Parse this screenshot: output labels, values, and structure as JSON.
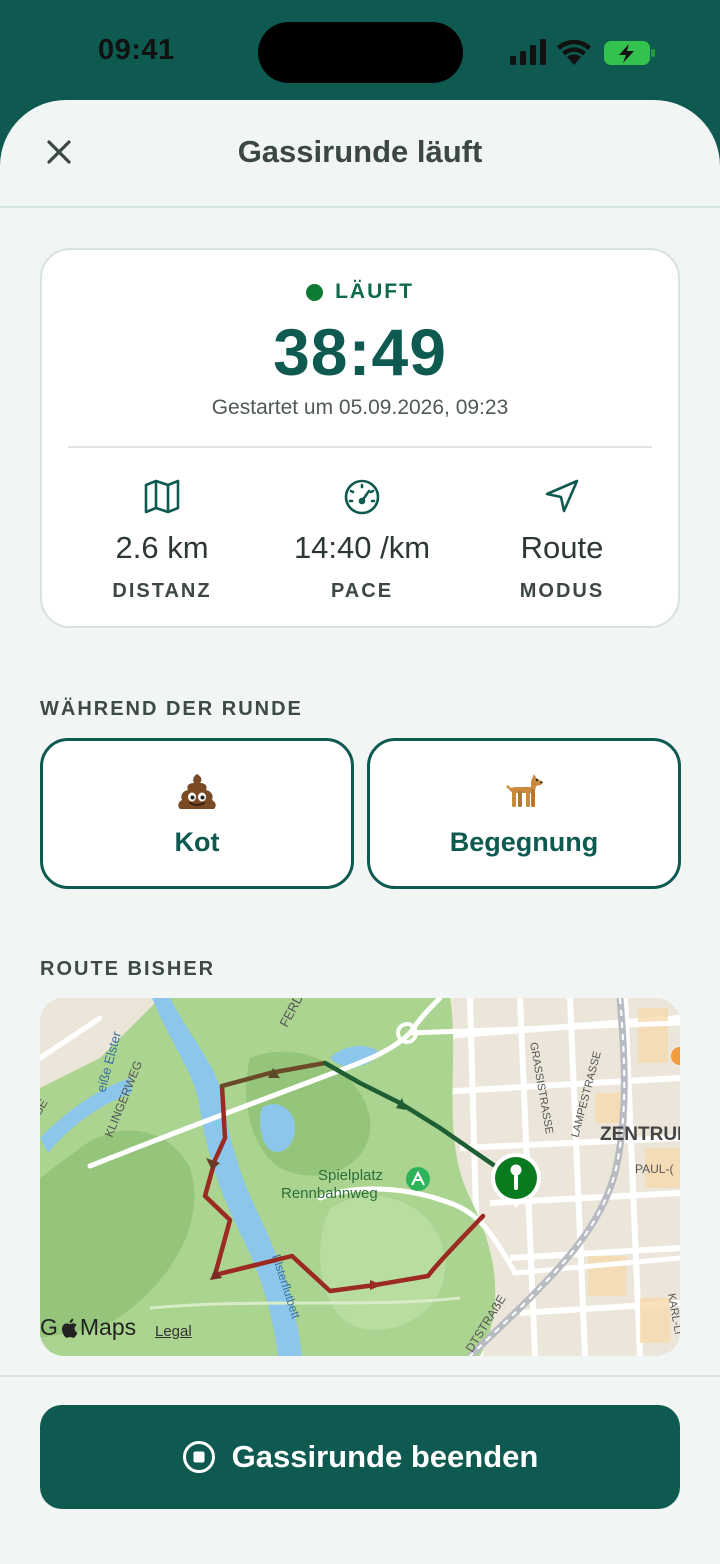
{
  "status_bar": {
    "time": "09:41"
  },
  "header": {
    "title": "Gassirunde läuft",
    "close_icon": "close-icon"
  },
  "timer_card": {
    "status": "LÄUFT",
    "status_color": "#0e7a34",
    "elapsed": "38:49",
    "started_text": "Gestartet um 05.09.2026, 09:23",
    "stats": [
      {
        "icon": "map-icon",
        "value": "2.6 km",
        "label": "DISTANZ"
      },
      {
        "icon": "speedometer-icon",
        "value": "14:40 /km",
        "label": "PACE"
      },
      {
        "icon": "navigation-arrow-icon",
        "value": "Route",
        "label": "MODUS"
      }
    ]
  },
  "during_section": {
    "title": "WÄHREND DER RUNDE",
    "actions": [
      {
        "icon": "poop-emoji",
        "label": "Kot"
      },
      {
        "icon": "dog-emoji",
        "label": "Begegnung"
      }
    ]
  },
  "route_section": {
    "title": "ROUTE BISHER",
    "map": {
      "labels": {
        "ferd": "FERD",
        "weisse_elster": "eiße Elster",
        "klingerweg": "KLINGERWEG",
        "grassistrasse": "GRASSISTRASSE",
        "lampestrasse": "LAMPESTRASSE",
        "zentrum": "ZENTRUI",
        "paul": "PAUL-(",
        "spielplatz_1": "Spielplatz",
        "spielplatz_2": "Rennbahnweg",
        "elsterflutbett": "Elsterflutbett",
        "dtstrasse": "DTSTRAẞE",
        "karl": "KARL-LI",
        "se": "SE"
      },
      "attribution": "Maps",
      "attribution_prefix": "G",
      "legal": "Legal",
      "route_colors": {
        "start": "#b22222",
        "middle": "#7a3b26",
        "end": "#1e5e32"
      },
      "pin_color": "#0a7a1e"
    }
  },
  "footer": {
    "end_button_label": "Gassirunde beenden"
  },
  "colors": {
    "primary": "#0e5a50",
    "background": "#f1f5f4",
    "accent_green": "#0e7a34"
  }
}
